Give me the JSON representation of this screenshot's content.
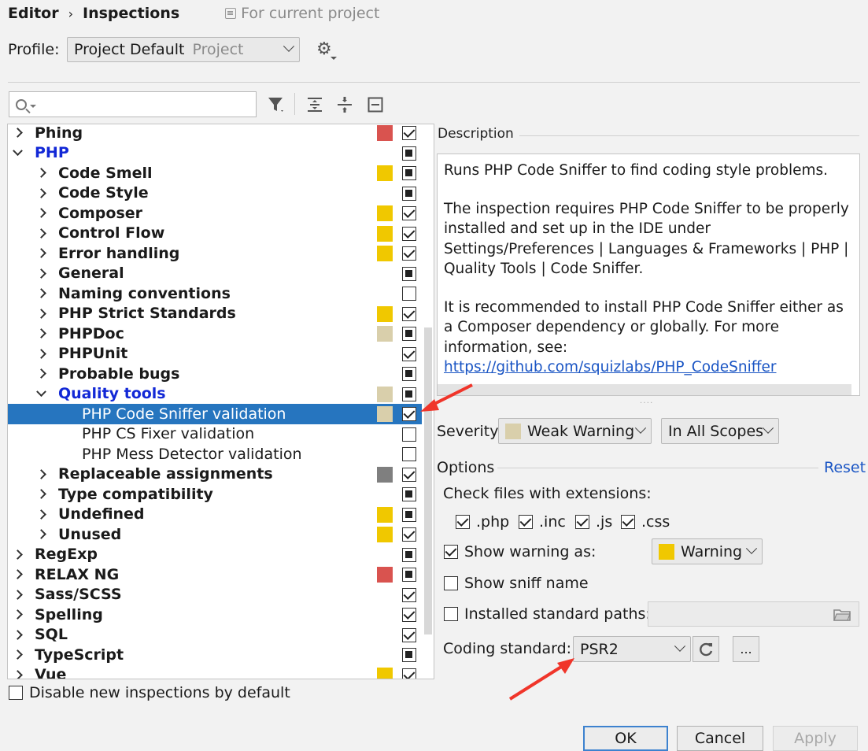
{
  "breadcrumb": {
    "parent": "Editor",
    "current": "Inspections",
    "scope": "For current project"
  },
  "profile": {
    "label": "Profile:",
    "value": "Project Default",
    "suffix": "Project"
  },
  "colors": {
    "error": "#d9534f",
    "warning": "#f0c800",
    "weak_warning": "#d9cfab",
    "server_problem": "#7f7f7f",
    "selection": "#2675bf",
    "link": "#1a55c4",
    "annotation": "#f0352a"
  },
  "tree": [
    {
      "label": "Phing",
      "level": 0,
      "arrow": "collapsed",
      "style": "bold",
      "severity": "error",
      "check": "checked"
    },
    {
      "label": "PHP",
      "level": 0,
      "arrow": "expanded",
      "style": "bold-blue",
      "severity": "",
      "check": "partial"
    },
    {
      "label": "Code Smell",
      "level": 1,
      "arrow": "collapsed",
      "style": "bold",
      "severity": "warning",
      "check": "partial"
    },
    {
      "label": "Code Style",
      "level": 1,
      "arrow": "collapsed",
      "style": "bold",
      "severity": "",
      "check": "partial"
    },
    {
      "label": "Composer",
      "level": 1,
      "arrow": "collapsed",
      "style": "bold",
      "severity": "warning",
      "check": "checked"
    },
    {
      "label": "Control Flow",
      "level": 1,
      "arrow": "collapsed",
      "style": "bold",
      "severity": "warning",
      "check": "checked"
    },
    {
      "label": "Error handling",
      "level": 1,
      "arrow": "collapsed",
      "style": "bold",
      "severity": "warning",
      "check": "checked"
    },
    {
      "label": "General",
      "level": 1,
      "arrow": "collapsed",
      "style": "bold",
      "severity": "",
      "check": "partial"
    },
    {
      "label": "Naming conventions",
      "level": 1,
      "arrow": "collapsed",
      "style": "bold",
      "severity": "",
      "check": "unchecked"
    },
    {
      "label": "PHP Strict Standards",
      "level": 1,
      "arrow": "collapsed",
      "style": "bold",
      "severity": "warning",
      "check": "checked"
    },
    {
      "label": "PHPDoc",
      "level": 1,
      "arrow": "collapsed",
      "style": "bold",
      "severity": "weak_warning",
      "check": "partial"
    },
    {
      "label": "PHPUnit",
      "level": 1,
      "arrow": "collapsed",
      "style": "bold",
      "severity": "",
      "check": "checked"
    },
    {
      "label": "Probable bugs",
      "level": 1,
      "arrow": "collapsed",
      "style": "bold",
      "severity": "",
      "check": "partial"
    },
    {
      "label": "Quality tools",
      "level": 1,
      "arrow": "expanded",
      "style": "bold-blue",
      "severity": "weak_warning",
      "check": "partial"
    },
    {
      "label": "PHP Code Sniffer validation",
      "level": 2,
      "arrow": "",
      "style": "normal",
      "severity": "weak_warning",
      "check": "checked",
      "selected": true
    },
    {
      "label": "PHP CS Fixer validation",
      "level": 2,
      "arrow": "",
      "style": "normal",
      "severity": "",
      "check": "unchecked"
    },
    {
      "label": "PHP Mess Detector validation",
      "level": 2,
      "arrow": "",
      "style": "normal",
      "severity": "",
      "check": "unchecked"
    },
    {
      "label": "Replaceable assignments",
      "level": 1,
      "arrow": "collapsed",
      "style": "bold",
      "severity": "server_problem",
      "check": "checked"
    },
    {
      "label": "Type compatibility",
      "level": 1,
      "arrow": "collapsed",
      "style": "bold",
      "severity": "",
      "check": "partial"
    },
    {
      "label": "Undefined",
      "level": 1,
      "arrow": "collapsed",
      "style": "bold",
      "severity": "warning",
      "check": "partial"
    },
    {
      "label": "Unused",
      "level": 1,
      "arrow": "collapsed",
      "style": "bold",
      "severity": "warning",
      "check": "checked"
    },
    {
      "label": "RegExp",
      "level": 0,
      "arrow": "collapsed",
      "style": "bold",
      "severity": "",
      "check": "partial"
    },
    {
      "label": "RELAX NG",
      "level": 0,
      "arrow": "collapsed",
      "style": "bold",
      "severity": "error",
      "check": "partial"
    },
    {
      "label": "Sass/SCSS",
      "level": 0,
      "arrow": "collapsed",
      "style": "bold",
      "severity": "",
      "check": "checked"
    },
    {
      "label": "Spelling",
      "level": 0,
      "arrow": "collapsed",
      "style": "bold",
      "severity": "",
      "check": "checked"
    },
    {
      "label": "SQL",
      "level": 0,
      "arrow": "collapsed",
      "style": "bold",
      "severity": "",
      "check": "checked"
    },
    {
      "label": "TypeScript",
      "level": 0,
      "arrow": "collapsed",
      "style": "bold",
      "severity": "",
      "check": "partial"
    },
    {
      "label": "Vue",
      "level": 0,
      "arrow": "collapsed",
      "style": "bold",
      "severity": "warning",
      "check": "checked"
    }
  ],
  "disable_new": {
    "label": "Disable new inspections by default",
    "checked": false
  },
  "description": {
    "title": "Description",
    "p1": "Runs PHP Code Sniffer to find coding style problems.",
    "p2": "The inspection requires PHP Code Sniffer to be properly installed and set up in the IDE under Settings/Preferences | Languages & Frameworks | PHP | Quality Tools | Code Sniffer.",
    "p3": "It is recommended to install PHP Code Sniffer either as a Composer dependency or globally. For more information, see: ",
    "link": "https://github.com/squizlabs/PHP_CodeSniffer"
  },
  "severity": {
    "label": "Severity:",
    "value": "Weak Warning",
    "scope": "In All Scopes"
  },
  "options": {
    "title": "Options",
    "reset": "Reset",
    "extensions_label": "Check files with extensions:",
    "extensions": [
      ".php",
      ".inc",
      ".js",
      ".css"
    ],
    "show_warning_label": "Show warning as:",
    "show_warning_value": "Warning",
    "show_sniff_label": "Show sniff name",
    "installed_paths_label": "Installed standard paths:",
    "coding_standard_label": "Coding standard:",
    "coding_standard_value": "PSR2",
    "more_label": "..."
  },
  "buttons": {
    "ok": "OK",
    "cancel": "Cancel",
    "apply": "Apply"
  }
}
